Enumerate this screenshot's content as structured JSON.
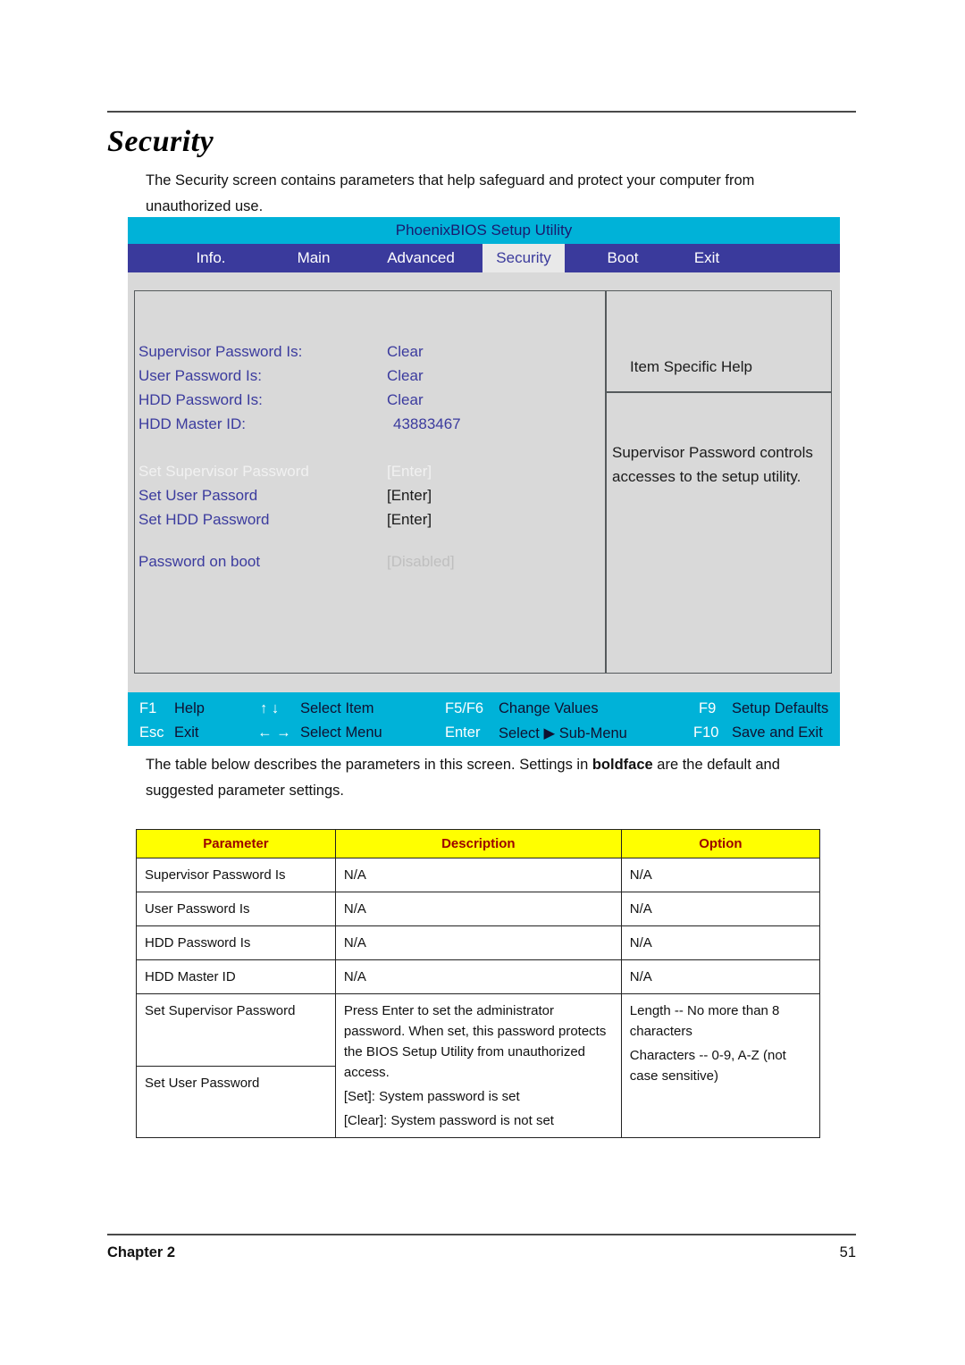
{
  "document": {
    "heading": "Security",
    "intro": "The Security screen contains parameters that help safeguard and protect your computer from unauthorized use.",
    "after_table_note_part1": "The table below describes the parameters in this screen. Settings in ",
    "after_table_note_bold": "boldface",
    "after_table_note_part2": " are the default and suggested  parameter settings.",
    "chapter": "Chapter 2",
    "page_number": "51"
  },
  "bios": {
    "title": "PhoenixBIOS Setup Utility",
    "tabs": [
      {
        "label": "Info.",
        "active": false
      },
      {
        "label": "Main",
        "active": false
      },
      {
        "label": "Advanced",
        "active": false
      },
      {
        "label": "Security",
        "active": true
      },
      {
        "label": "Boot",
        "active": false
      },
      {
        "label": "Exit",
        "active": false
      }
    ],
    "settings": [
      {
        "label": "Supervisor Password Is:",
        "value": "Clear"
      },
      {
        "label": "User Password Is:",
        "value": "Clear"
      },
      {
        "label": "HDD Password Is:",
        "value": "Clear"
      },
      {
        "label": "HDD Master ID:",
        "value": "43883467"
      },
      {
        "label": "Set Supervisor Password",
        "value": "[Enter]"
      },
      {
        "label": "Set User Passord",
        "value": "[Enter]"
      },
      {
        "label": "Set HDD Password",
        "value": "[Enter]"
      },
      {
        "label": "Password on boot",
        "value": "[Disabled]"
      }
    ],
    "help": {
      "title": "Item Specific Help",
      "text": "Supervisor Password controls accesses to the setup utility."
    },
    "footer_keys": [
      {
        "key": "F1",
        "desc": "Help"
      },
      {
        "key": "↑ ↓",
        "desc": "Select Item"
      },
      {
        "key": "F5/F6",
        "desc": "Change Values"
      },
      {
        "key": "F9",
        "desc": "Setup Defaults"
      },
      {
        "key": "Esc",
        "desc": "Exit"
      },
      {
        "key": "← →",
        "desc": "Select Menu"
      },
      {
        "key": "Enter",
        "desc": "Select ▶ Sub-Menu"
      },
      {
        "key": "F10",
        "desc": "Save and Exit"
      }
    ],
    "colors": {
      "title_bar": "#00b2d8",
      "nav_bar": "#3a3a9c",
      "body": "#d9d9d9",
      "text": "#3b3b9e",
      "active_tab_bg": "#e9e9e9"
    }
  },
  "table": {
    "headers": [
      "Parameter",
      "Description",
      "Option"
    ],
    "rows": [
      {
        "parameter": "Supervisor Password Is",
        "description": "N/A",
        "option": "N/A"
      },
      {
        "parameter": "User Password Is",
        "description": "N/A",
        "option": "N/A"
      },
      {
        "parameter": "HDD Password Is",
        "description": "N/A",
        "option": "N/A"
      },
      {
        "parameter": "HDD Master ID",
        "description": "N/A",
        "option": "N/A"
      }
    ],
    "merged_row": {
      "parameter_top": "Set Supervisor Password",
      "parameter_bottom": "Set User Password",
      "description_lines": [
        "Press Enter to set the administrator password. When set, this password protects the BIOS Setup Utility from unauthorized access.",
        "[Set]: System password is set",
        "[Clear]: System password is not set"
      ],
      "option_lines": [
        "Length -- No more than 8 characters",
        "Characters -- 0-9, A-Z (not case sensitive)"
      ]
    },
    "header_bg": "#ffff00",
    "header_color": "#9c0000"
  }
}
